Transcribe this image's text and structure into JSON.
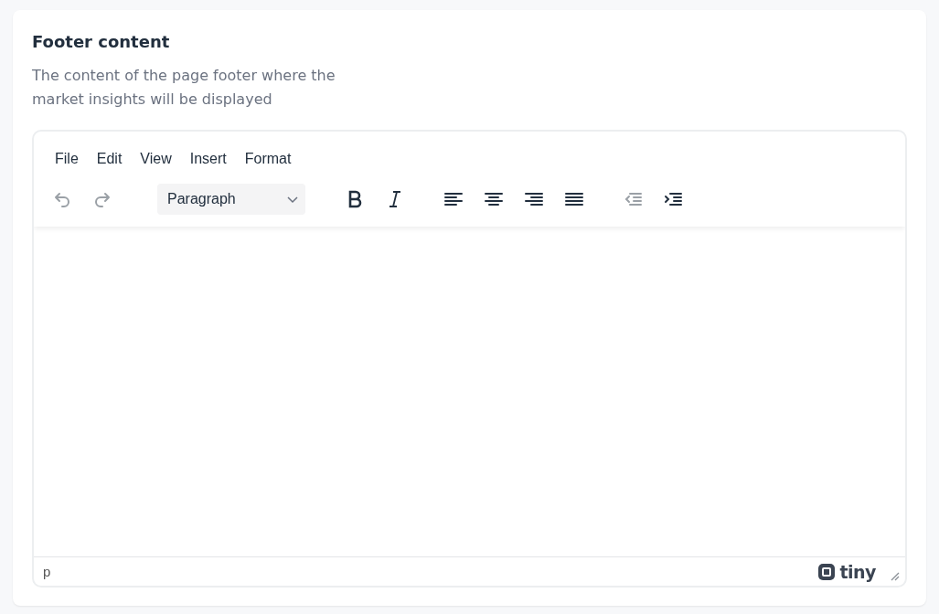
{
  "field": {
    "title": "Footer content",
    "description": "The content of the page footer where the market insights will be displayed"
  },
  "editor": {
    "menubar": [
      "File",
      "Edit",
      "View",
      "Insert",
      "Format"
    ],
    "toolbar": [
      {
        "kind": "buttons",
        "buttons": [
          {
            "kind": "undo",
            "disabled": true
          },
          {
            "kind": "redo",
            "disabled": true
          }
        ]
      },
      {
        "kind": "select",
        "value": "Paragraph"
      },
      {
        "kind": "buttons",
        "buttons": [
          {
            "kind": "bold",
            "disabled": false
          },
          {
            "kind": "italic",
            "disabled": false
          }
        ]
      },
      {
        "kind": "buttons",
        "buttons": [
          {
            "kind": "align-left",
            "disabled": false
          },
          {
            "kind": "align-center",
            "disabled": false
          },
          {
            "kind": "align-right",
            "disabled": false
          },
          {
            "kind": "justify",
            "disabled": false
          }
        ]
      },
      {
        "kind": "buttons",
        "buttons": [
          {
            "kind": "outdent",
            "disabled": true
          },
          {
            "kind": "indent",
            "disabled": false
          }
        ]
      }
    ],
    "path": "p",
    "brand": "tiny"
  }
}
